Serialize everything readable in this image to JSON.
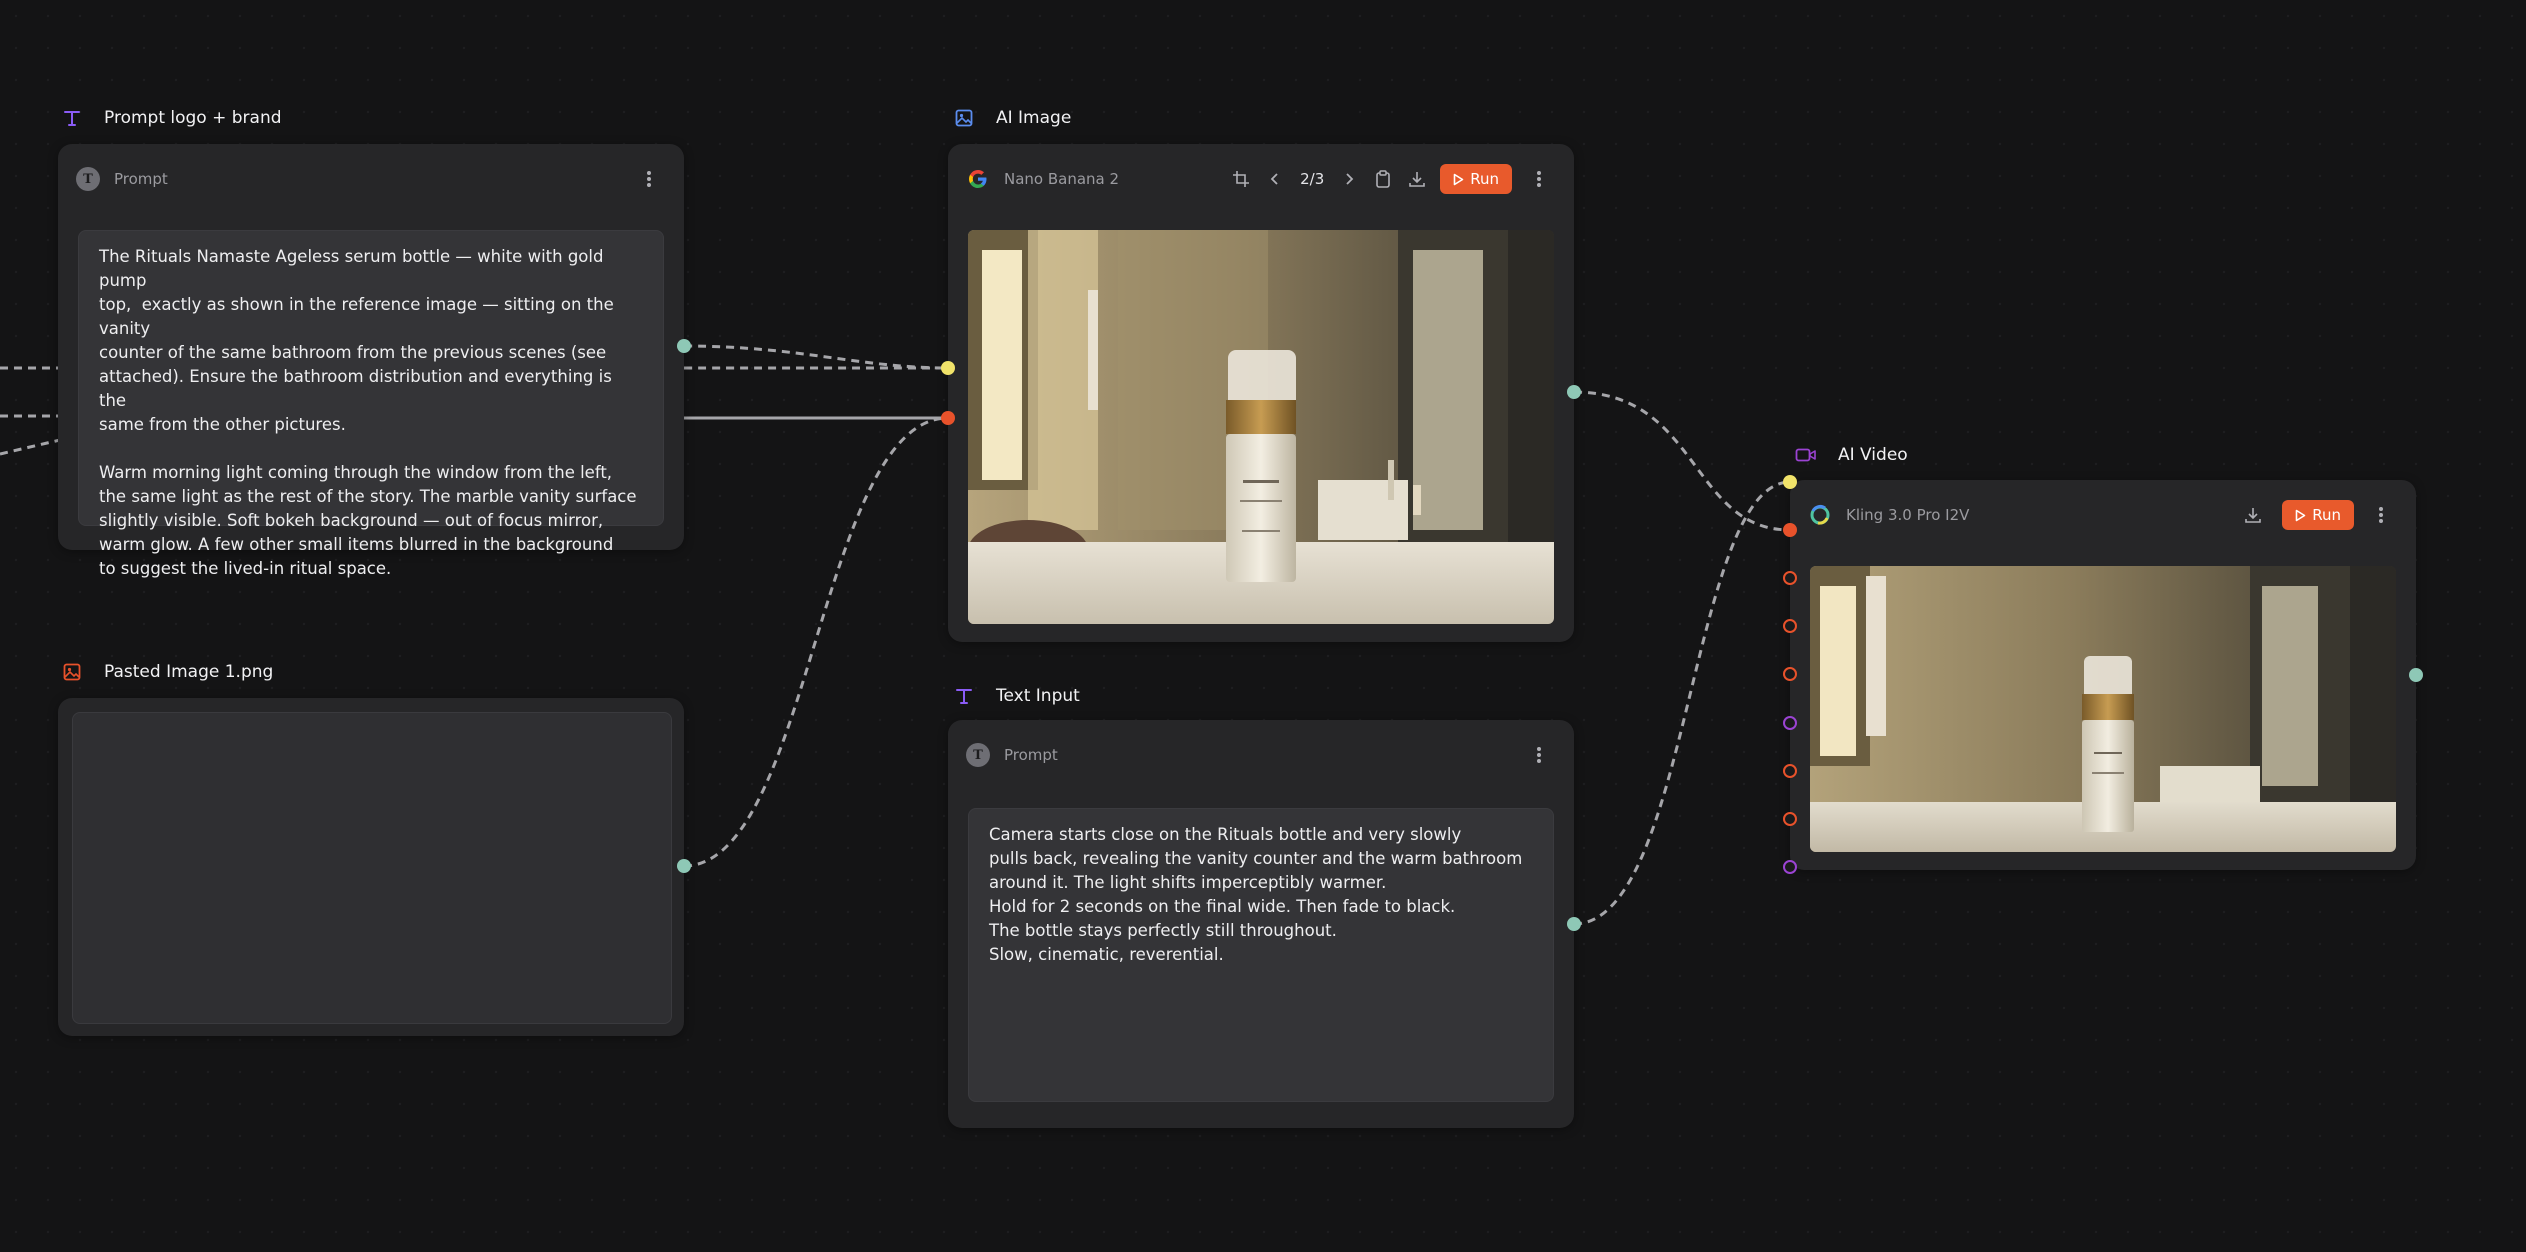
{
  "nodes": {
    "prompt_logo": {
      "title": "Prompt logo + brand",
      "title_icon": "text-type-icon",
      "header_label": "Prompt",
      "text": "The Rituals Namaste Ageless serum bottle — white with gold pump\ntop,  exactly as shown in the reference image — sitting on the vanity\ncounter of the same bathroom from the previous scenes (see\nattached). Ensure the bathroom distribution and everything is the\nsame from the other pictures.\n\nWarm morning light coming through the window from the left,\nthe same light as the rest of the story. The marble vanity surface\nslightly visible. Soft bokeh background — out of focus mirror,\nwarm glow. A few other small items blurred in the background\nto suggest the lived-in ritual space."
    },
    "pasted_image": {
      "title": "Pasted Image 1.png",
      "title_icon": "image-icon"
    },
    "ai_image": {
      "title": "AI Image",
      "title_icon": "image-icon",
      "model": "Nano Banana 2",
      "model_icon": "google-icon",
      "pager": "2/3",
      "run_label": "Run"
    },
    "text_input": {
      "title": "Text Input",
      "title_icon": "text-type-icon",
      "header_label": "Prompt",
      "text": "Camera starts close on the Rituals bottle and very slowly\npulls back, revealing the vanity counter and the warm bathroom\naround it. The light shifts imperceptibly warmer.\nHold for 2 seconds on the final wide. Then fade to black.\nThe bottle stays perfectly still throughout.\nSlow, cinematic, reverential."
    },
    "ai_video": {
      "title": "AI Video",
      "title_icon": "video-camera-icon",
      "model": "Kling 3.0 Pro I2V",
      "model_icon": "kling-icon",
      "run_label": "Run"
    }
  },
  "colors": {
    "canvas": "#141415",
    "card": "#262628",
    "run": "#e85a2c",
    "port_teal": "#8ec8b6",
    "port_yellow": "#f1e36a",
    "port_orange": "#e8522b",
    "port_purple": "#9b43d3",
    "wire": "#a6a6aa"
  }
}
